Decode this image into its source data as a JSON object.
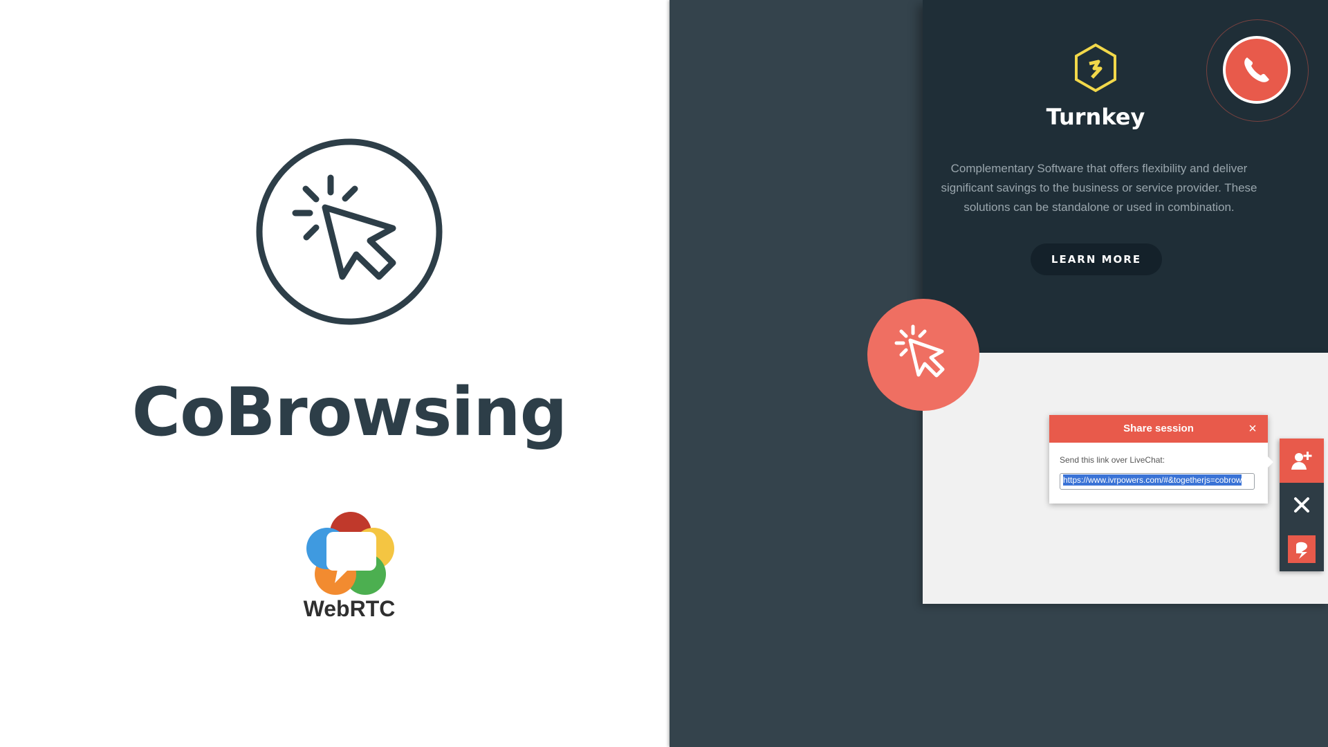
{
  "promo": {
    "title": "CoBrowsing",
    "webrtc_label": "WebRTC"
  },
  "site": {
    "title": "Turnkey",
    "description": "Complementary Software that offers flexibility and deliver significant savings to the business or service provider. These solutions can be standalone or used in combination.",
    "learn_more_label": "LEARN MORE"
  },
  "share_dialog": {
    "title": "Share session",
    "label": "Send this link over LiveChat:",
    "link_value": "https://www.ivrpowers.com/#&togetherjs=cobrow",
    "close_glyph": "×"
  },
  "colors": {
    "accent": "#e85a4b",
    "dark": "#1f2e37",
    "panel": "#34434c",
    "hex_logo": "#f2d84a"
  },
  "icons": {
    "promo_icon": "cursor-click-icon",
    "call_icon": "phone-icon",
    "badge_icon": "cursor-click-icon",
    "toolbar": [
      "add-user-icon",
      "close-icon",
      "brand-logo-icon"
    ]
  }
}
